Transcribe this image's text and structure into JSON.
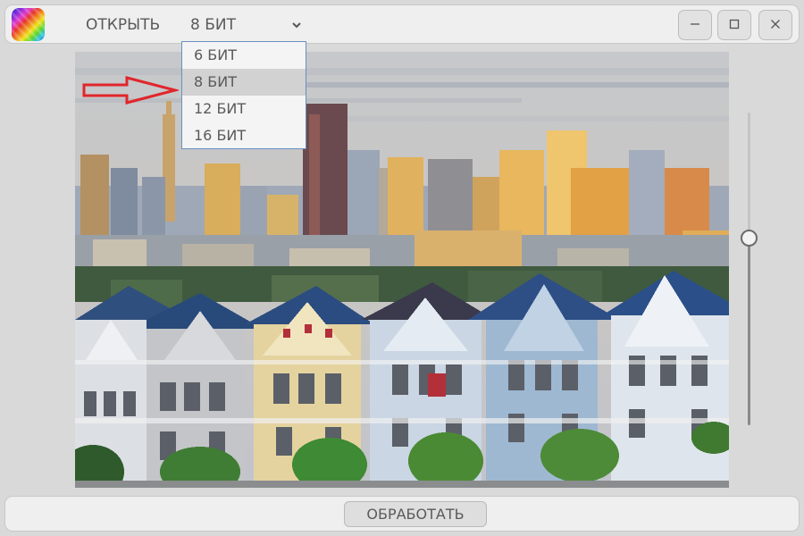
{
  "toolbar": {
    "open_label": "ОТКРЫТЬ",
    "bit_depth_value": "8 БИТ",
    "bit_depth_icon": "chevron-down-icon"
  },
  "window_controls": {
    "minimize_icon": "minimize-icon",
    "maximize_icon": "maximize-icon",
    "close_icon": "close-icon"
  },
  "bit_depth_dropdown": {
    "options": [
      "6 БИТ",
      "8 БИТ",
      "12 БИТ",
      "16 БИТ"
    ],
    "selected_index": 1
  },
  "annotation": {
    "arrow_color": "#e0262b",
    "arrow_icon": "red-arrow-right-icon"
  },
  "preview": {
    "image_icon": "photo-painted-ladies-san-francisco"
  },
  "slider": {
    "level": 0.6
  },
  "actions": {
    "process_label": "ОБРАБОТАТЬ"
  },
  "colors": {
    "window_bg": "#d9d9d9",
    "bar_bg": "#efefef",
    "dropdown_border": "#6b8fc0",
    "dropdown_selected": "#d2d2d2"
  }
}
